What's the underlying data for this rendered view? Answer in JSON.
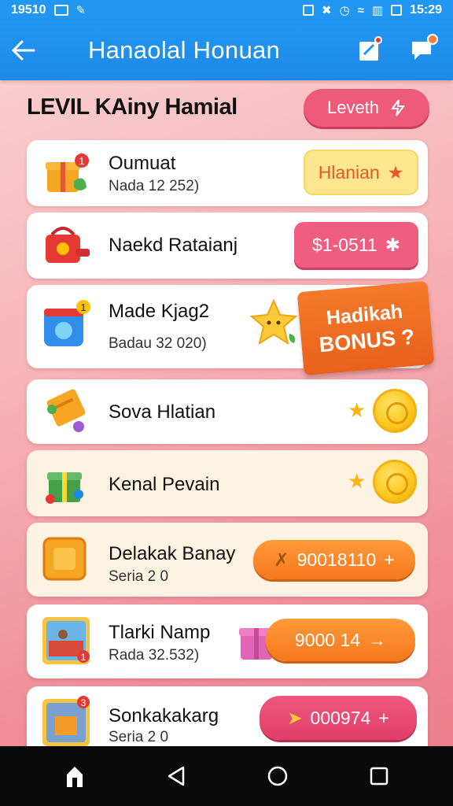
{
  "status_bar": {
    "time_left": "19510",
    "time_right": "15:29"
  },
  "app_bar": {
    "title": "Hanaolal Honuan"
  },
  "header": {
    "title": "LEVIL KAiny Hamial",
    "level_button": "Leveth"
  },
  "cards": [
    {
      "title": "Oumuat",
      "subtitle": "Nada 12 252)",
      "button": "Hlanian"
    },
    {
      "title": "Naekd Rataianj",
      "button": "$1-0511"
    },
    {
      "title": "Made Kjag2",
      "subtitle": "Badau 32 020)",
      "bonus_line1": "Hadikah",
      "bonus_line2": "BONUS ?"
    },
    {
      "title": "Sova Hlatian"
    },
    {
      "title": "Kenal Pevain"
    },
    {
      "title": "Delakak Banay",
      "subtitle": "Seria 2 0",
      "button": "90018110"
    },
    {
      "title": "Tlarki Namp",
      "subtitle": "Rada 32.532)",
      "button": "9000 14"
    },
    {
      "title": "Sonkakakarg",
      "subtitle": "Seria 2 0",
      "button": "000974"
    }
  ],
  "icons": {
    "back": "arrow-left-icon",
    "edit": "edit-note-icon",
    "chat": "chat-bubble-icon"
  },
  "colors": {
    "appbar": "#2196f3",
    "accent_pink": "#ef5e80",
    "accent_orange": "#f5781d"
  }
}
